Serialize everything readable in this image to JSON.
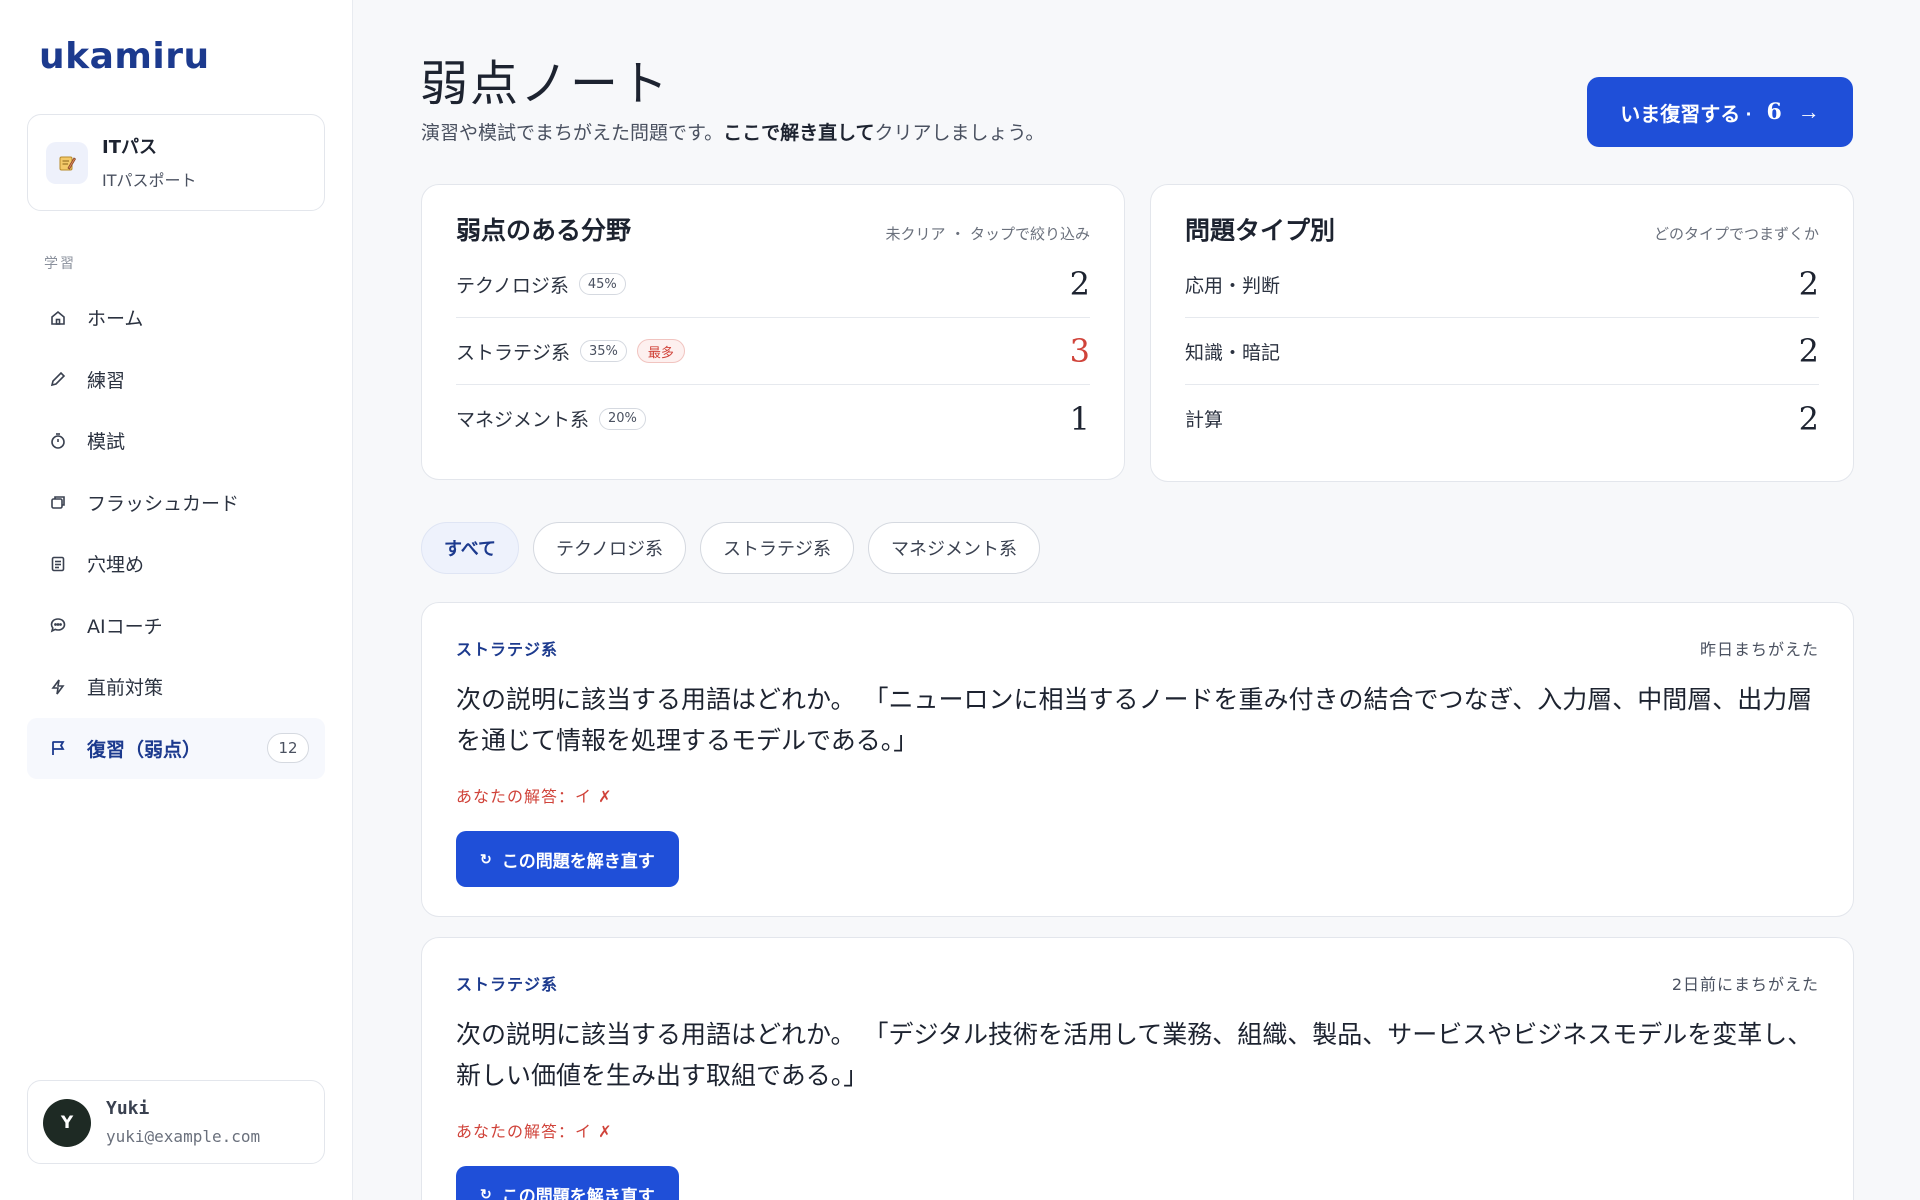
{
  "brand": {
    "logo": "ukamiru"
  },
  "exam": {
    "title": "ITパス",
    "subtitle": "ITパスポート",
    "icon": "memo-icon"
  },
  "sidebar": {
    "section_label": "学習",
    "items": [
      {
        "label": "ホーム",
        "icon": "home-icon"
      },
      {
        "label": "練習",
        "icon": "pencil-icon"
      },
      {
        "label": "模試",
        "icon": "timer-icon"
      },
      {
        "label": "フラッシュカード",
        "icon": "cards-icon"
      },
      {
        "label": "穴埋め",
        "icon": "document-icon"
      },
      {
        "label": "AIコーチ",
        "icon": "chat-icon"
      },
      {
        "label": "直前対策",
        "icon": "bolt-icon"
      },
      {
        "label": "復習（弱点）",
        "icon": "flag-icon",
        "badge": "12",
        "active": true
      }
    ]
  },
  "user": {
    "initial": "Y",
    "name": "Yuki",
    "email": "yuki@example.com"
  },
  "header": {
    "title": "弱点ノート",
    "subtitle_pre": "演習や模試でまちがえた問題です。",
    "subtitle_bold": "ここで解き直して",
    "subtitle_post": "クリアしましょう。",
    "review_button": {
      "label": "いま復習する ·",
      "count": "6",
      "arrow": "→"
    }
  },
  "weak_fields": {
    "title": "弱点のある分野",
    "hint": "未クリア ・ タップで絞り込み",
    "rows": [
      {
        "name": "テクノロジ系",
        "pct": "45%",
        "value": "2"
      },
      {
        "name": "ストラテジ系",
        "pct": "35%",
        "tag": "最多",
        "value": "3"
      },
      {
        "name": "マネジメント系",
        "pct": "20%",
        "value": "1"
      }
    ]
  },
  "question_types": {
    "title": "問題タイプ別",
    "hint": "どのタイプでつまずくか",
    "rows": [
      {
        "name": "応用・判断",
        "value": "2"
      },
      {
        "name": "知識・暗記",
        "value": "2"
      },
      {
        "name": "計算",
        "value": "2"
      }
    ]
  },
  "filters": [
    "すべて",
    "テクノロジ系",
    "ストラテジ系",
    "マネジメント系"
  ],
  "questions": [
    {
      "category": "ストラテジ系",
      "when": "昨日まちがえた",
      "text": "次の説明に該当する用語はどれか。 「ニューロンに相当するノードを重み付きの結合でつなぎ、入力層、中間層、出力層を通じて情報を処理するモデルである。」",
      "answer": "あなたの解答：イ ✗",
      "retry_label": "この問題を解き直す"
    },
    {
      "category": "ストラテジ系",
      "when": "2日前にまちがえた",
      "text": "次の説明に該当する用語はどれか。 「デジタル技術を活用して業務、組織、製品、サービスやビジネスモデルを変革し、新しい価値を生み出す取組である。」",
      "answer": "あなたの解答：イ ✗",
      "retry_label": "この問題を解き直す"
    }
  ],
  "colors": {
    "accent": "#1f4fd8",
    "brand": "#1c3a8e",
    "alert": "#d0433a"
  }
}
